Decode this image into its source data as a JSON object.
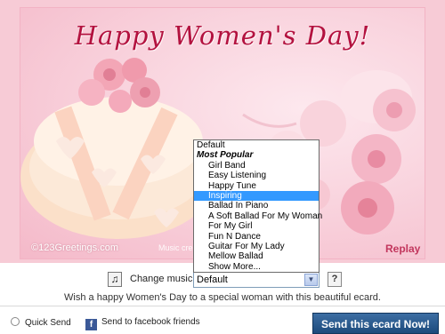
{
  "card": {
    "title": "Happy Women's Day!",
    "watermark": "©123Greetings.com",
    "music_credit": "Music cre",
    "replay_label": "Replay"
  },
  "controls": {
    "change_music_label": "Change music:",
    "selected_value": "Default",
    "help_label": "?"
  },
  "dropdown": {
    "options": [
      {
        "label": "Default",
        "kind": "plain"
      },
      {
        "label": "Most Popular",
        "kind": "group"
      },
      {
        "label": "Girl Band",
        "kind": "item"
      },
      {
        "label": "Easy Listening",
        "kind": "item"
      },
      {
        "label": "Happy Tune",
        "kind": "item"
      },
      {
        "label": "Inspiring",
        "kind": "selected"
      },
      {
        "label": "Ballad In Piano",
        "kind": "item"
      },
      {
        "label": "A Soft Ballad For My Woman",
        "kind": "item"
      },
      {
        "label": "For My Girl",
        "kind": "item"
      },
      {
        "label": "Fun N Dance",
        "kind": "item"
      },
      {
        "label": "Guitar For My Lady",
        "kind": "item"
      },
      {
        "label": "Mellow Ballad",
        "kind": "item"
      },
      {
        "label": "Show More...",
        "kind": "item"
      }
    ]
  },
  "tagline": "Wish a happy Women's Day to a special woman with this beautiful ecard.",
  "footer": {
    "quick_send": "Quick Send",
    "facebook_send": "Send to facebook friends",
    "send_button": "Send this ecard Now!"
  },
  "colors": {
    "title": "#b3123f",
    "accent_blue": "#1c4a7c",
    "selection": "#3399ff"
  },
  "icons": {
    "music": "music-note-icon",
    "help": "help-icon",
    "quick_send": "quick-send-icon",
    "facebook": "facebook-icon",
    "dropdown_arrow": "chevron-down-icon"
  }
}
